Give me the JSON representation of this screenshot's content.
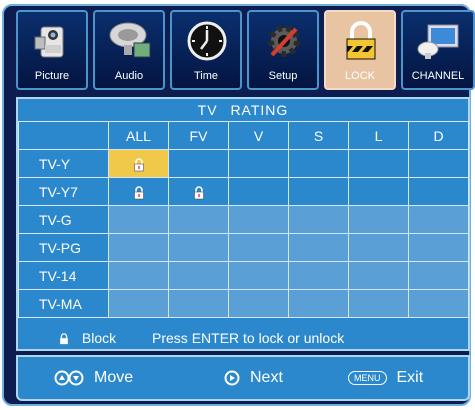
{
  "tabs": [
    {
      "label": "Picture",
      "icon": "camera-icon"
    },
    {
      "label": "Audio",
      "icon": "audio-icon"
    },
    {
      "label": "Time",
      "icon": "clock-icon"
    },
    {
      "label": "Setup",
      "icon": "gear-wrench-icon"
    },
    {
      "label": "LOCK",
      "icon": "padlock-icon"
    },
    {
      "label": "CHANNEL",
      "icon": "satellite-dish-icon"
    }
  ],
  "active_tab": "LOCK",
  "grid": {
    "title": "TV RATING",
    "columns": [
      "ALL",
      "FV",
      "V",
      "S",
      "L",
      "D"
    ],
    "rows": [
      {
        "label": "TV-Y",
        "locked": [
          true,
          false,
          false,
          false,
          false,
          false
        ]
      },
      {
        "label": "TV-Y7",
        "locked": [
          true,
          true,
          false,
          false,
          false,
          false
        ]
      },
      {
        "label": "TV-G",
        "locked": [
          false,
          false,
          false,
          false,
          false,
          false
        ]
      },
      {
        "label": "TV-PG",
        "locked": [
          false,
          false,
          false,
          false,
          false,
          false
        ]
      },
      {
        "label": "TV-14",
        "locked": [
          false,
          false,
          false,
          false,
          false,
          false
        ]
      },
      {
        "label": "TV-MA",
        "locked": [
          false,
          false,
          false,
          false,
          false,
          false
        ]
      }
    ],
    "selected_cell": {
      "row": "TV-Y",
      "column": "ALL"
    }
  },
  "legend": {
    "block_label": "Block",
    "hint": "Press ENTER to lock or unlock"
  },
  "footer": {
    "move_label": "Move",
    "next_label": "Next",
    "menu_key": "MENU",
    "exit_label": "Exit"
  },
  "colors": {
    "background": "#0d1d4f",
    "panel": "#2c88cc",
    "cell": "#5a9fd6",
    "selected": "#f0c94a",
    "active_tab": "#e8c4a3"
  }
}
